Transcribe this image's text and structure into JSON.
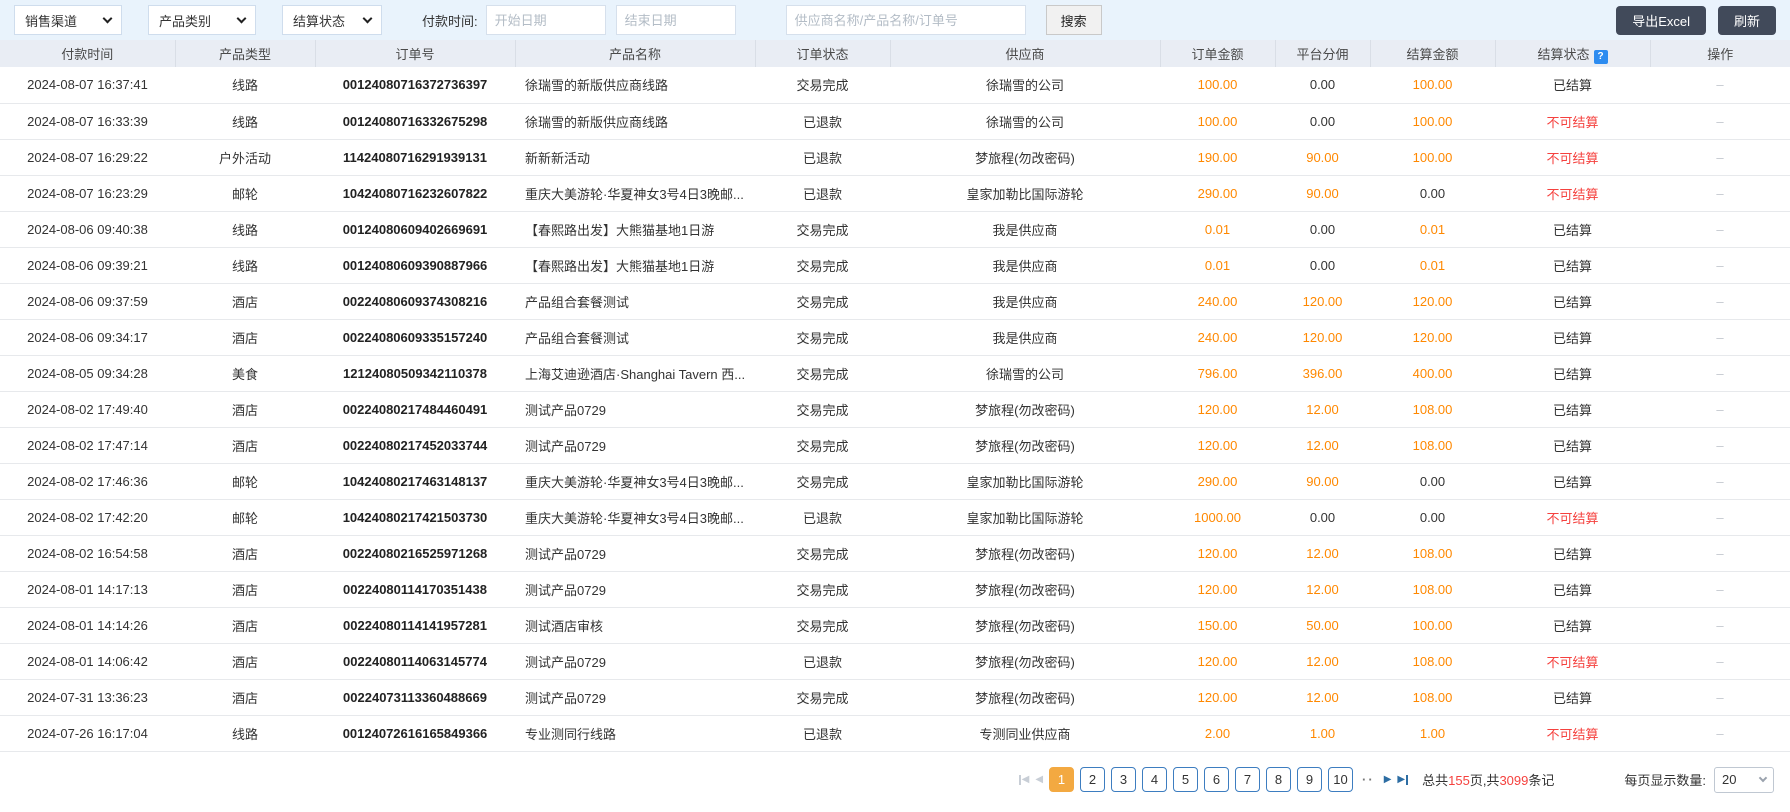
{
  "toolbar": {
    "filters": [
      {
        "label": "销售渠道"
      },
      {
        "label": "产品类别"
      },
      {
        "label": "结算状态"
      }
    ],
    "payment_time_label": "付款时间:",
    "start_date_placeholder": "开始日期",
    "end_date_placeholder": "结束日期",
    "search_placeholder": "供应商名称/产品名称/订单号",
    "search_button": "搜索",
    "export_button": "导出Excel",
    "refresh_button": "刷新"
  },
  "table": {
    "columns": [
      "付款时间",
      "产品类型",
      "订单号",
      "产品名称",
      "订单状态",
      "供应商",
      "订单金额",
      "平台分佣",
      "结算金额",
      "结算状态",
      "操作"
    ],
    "help_icon": "?",
    "rows": [
      {
        "payment_time": "2024-08-07 16:37:41",
        "product_type": "线路",
        "order_no": "00124080716372736397",
        "product_name": "徐瑞雪的新版供应商线路",
        "order_status": "交易完成",
        "supplier": "徐瑞雪的公司",
        "order_amount": "100.00",
        "commission": "0.00",
        "settlement_amount": "100.00",
        "settlement_status": "已结算",
        "action": "–"
      },
      {
        "payment_time": "2024-08-07 16:33:39",
        "product_type": "线路",
        "order_no": "00124080716332675298",
        "product_name": "徐瑞雪的新版供应商线路",
        "order_status": "已退款",
        "supplier": "徐瑞雪的公司",
        "order_amount": "100.00",
        "commission": "0.00",
        "settlement_amount": "100.00",
        "settlement_status": "不可结算",
        "action": "–"
      },
      {
        "payment_time": "2024-08-07 16:29:22",
        "product_type": "户外活动",
        "order_no": "11424080716291939131",
        "product_name": "新新新活动",
        "order_status": "已退款",
        "supplier": "梦旅程(勿改密码)",
        "order_amount": "190.00",
        "commission": "90.00",
        "settlement_amount": "100.00",
        "settlement_status": "不可结算",
        "action": "–"
      },
      {
        "payment_time": "2024-08-07 16:23:29",
        "product_type": "邮轮",
        "order_no": "10424080716232607822",
        "product_name": "重庆大美游轮·华夏神女3号4日3晚邮...",
        "order_status": "已退款",
        "supplier": "皇家加勒比国际游轮",
        "order_amount": "290.00",
        "commission": "90.00",
        "settlement_amount": "0.00",
        "settlement_status": "不可结算",
        "action": "–"
      },
      {
        "payment_time": "2024-08-06 09:40:38",
        "product_type": "线路",
        "order_no": "00124080609402669691",
        "product_name": "【春熙路出发】大熊猫基地1日游",
        "order_status": "交易完成",
        "supplier": "我是供应商",
        "order_amount": "0.01",
        "commission": "0.00",
        "settlement_amount": "0.01",
        "settlement_status": "已结算",
        "action": "–"
      },
      {
        "payment_time": "2024-08-06 09:39:21",
        "product_type": "线路",
        "order_no": "00124080609390887966",
        "product_name": "【春熙路出发】大熊猫基地1日游",
        "order_status": "交易完成",
        "supplier": "我是供应商",
        "order_amount": "0.01",
        "commission": "0.00",
        "settlement_amount": "0.01",
        "settlement_status": "已结算",
        "action": "–"
      },
      {
        "payment_time": "2024-08-06 09:37:59",
        "product_type": "酒店",
        "order_no": "00224080609374308216",
        "product_name": "产品组合套餐测试",
        "order_status": "交易完成",
        "supplier": "我是供应商",
        "order_amount": "240.00",
        "commission": "120.00",
        "settlement_amount": "120.00",
        "settlement_status": "已结算",
        "action": "–"
      },
      {
        "payment_time": "2024-08-06 09:34:17",
        "product_type": "酒店",
        "order_no": "00224080609335157240",
        "product_name": "产品组合套餐测试",
        "order_status": "交易完成",
        "supplier": "我是供应商",
        "order_amount": "240.00",
        "commission": "120.00",
        "settlement_amount": "120.00",
        "settlement_status": "已结算",
        "action": "–"
      },
      {
        "payment_time": "2024-08-05 09:34:28",
        "product_type": "美食",
        "order_no": "12124080509342110378",
        "product_name": "上海艾迪逊酒店·Shanghai Tavern 西...",
        "order_status": "交易完成",
        "supplier": "徐瑞雪的公司",
        "order_amount": "796.00",
        "commission": "396.00",
        "settlement_amount": "400.00",
        "settlement_status": "已结算",
        "action": "–"
      },
      {
        "payment_time": "2024-08-02 17:49:40",
        "product_type": "酒店",
        "order_no": "00224080217484460491",
        "product_name": "测试产品0729",
        "order_status": "交易完成",
        "supplier": "梦旅程(勿改密码)",
        "order_amount": "120.00",
        "commission": "12.00",
        "settlement_amount": "108.00",
        "settlement_status": "已结算",
        "action": "–"
      },
      {
        "payment_time": "2024-08-02 17:47:14",
        "product_type": "酒店",
        "order_no": "00224080217452033744",
        "product_name": "测试产品0729",
        "order_status": "交易完成",
        "supplier": "梦旅程(勿改密码)",
        "order_amount": "120.00",
        "commission": "12.00",
        "settlement_amount": "108.00",
        "settlement_status": "已结算",
        "action": "–"
      },
      {
        "payment_time": "2024-08-02 17:46:36",
        "product_type": "邮轮",
        "order_no": "10424080217463148137",
        "product_name": "重庆大美游轮·华夏神女3号4日3晚邮...",
        "order_status": "交易完成",
        "supplier": "皇家加勒比国际游轮",
        "order_amount": "290.00",
        "commission": "90.00",
        "settlement_amount": "0.00",
        "settlement_status": "已结算",
        "action": "–"
      },
      {
        "payment_time": "2024-08-02 17:42:20",
        "product_type": "邮轮",
        "order_no": "10424080217421503730",
        "product_name": "重庆大美游轮·华夏神女3号4日3晚邮...",
        "order_status": "已退款",
        "supplier": "皇家加勒比国际游轮",
        "order_amount": "1000.00",
        "commission": "0.00",
        "settlement_amount": "0.00",
        "settlement_status": "不可结算",
        "action": "–"
      },
      {
        "payment_time": "2024-08-02 16:54:58",
        "product_type": "酒店",
        "order_no": "00224080216525971268",
        "product_name": "测试产品0729",
        "order_status": "交易完成",
        "supplier": "梦旅程(勿改密码)",
        "order_amount": "120.00",
        "commission": "12.00",
        "settlement_amount": "108.00",
        "settlement_status": "已结算",
        "action": "–"
      },
      {
        "payment_time": "2024-08-01 14:17:13",
        "product_type": "酒店",
        "order_no": "00224080114170351438",
        "product_name": "测试产品0729",
        "order_status": "交易完成",
        "supplier": "梦旅程(勿改密码)",
        "order_amount": "120.00",
        "commission": "12.00",
        "settlement_amount": "108.00",
        "settlement_status": "已结算",
        "action": "–"
      },
      {
        "payment_time": "2024-08-01 14:14:26",
        "product_type": "酒店",
        "order_no": "00224080114141957281",
        "product_name": "测试酒店审核",
        "order_status": "交易完成",
        "supplier": "梦旅程(勿改密码)",
        "order_amount": "150.00",
        "commission": "50.00",
        "settlement_amount": "100.00",
        "settlement_status": "已结算",
        "action": "–"
      },
      {
        "payment_time": "2024-08-01 14:06:42",
        "product_type": "酒店",
        "order_no": "00224080114063145774",
        "product_name": "测试产品0729",
        "order_status": "已退款",
        "supplier": "梦旅程(勿改密码)",
        "order_amount": "120.00",
        "commission": "12.00",
        "settlement_amount": "108.00",
        "settlement_status": "不可结算",
        "action": "–"
      },
      {
        "payment_time": "2024-07-31 13:36:23",
        "product_type": "酒店",
        "order_no": "00224073113360488669",
        "product_name": "测试产品0729",
        "order_status": "交易完成",
        "supplier": "梦旅程(勿改密码)",
        "order_amount": "120.00",
        "commission": "12.00",
        "settlement_amount": "108.00",
        "settlement_status": "已结算",
        "action": "–"
      },
      {
        "payment_time": "2024-07-26 16:17:04",
        "product_type": "线路",
        "order_no": "00124072616165849366",
        "product_name": "专业测同行线路",
        "order_status": "已退款",
        "supplier": "专测同业供应商",
        "order_amount": "2.00",
        "commission": "1.00",
        "settlement_amount": "1.00",
        "settlement_status": "不可结算",
        "action": "–"
      }
    ]
  },
  "pagination": {
    "pages": [
      "1",
      "2",
      "3",
      "4",
      "5",
      "6",
      "7",
      "8",
      "9",
      "10"
    ],
    "active_page": "1",
    "ellipsis": "··",
    "total_prefix": "总共",
    "total_pages": "155",
    "total_middle": "页,共",
    "total_records": "3099",
    "total_suffix": "条记",
    "page_size_label": "每页显示数量:",
    "page_size": "20"
  },
  "colors": {
    "accent_orange": "#ff8800",
    "alert_red": "#f5413e",
    "link_blue": "#2d8cf0",
    "active_page_bg": "#f3a941",
    "dark_button_bg": "#414a5a",
    "toolbar_bg": "#e9f3fc",
    "table_header_bg": "#e9edf4"
  }
}
